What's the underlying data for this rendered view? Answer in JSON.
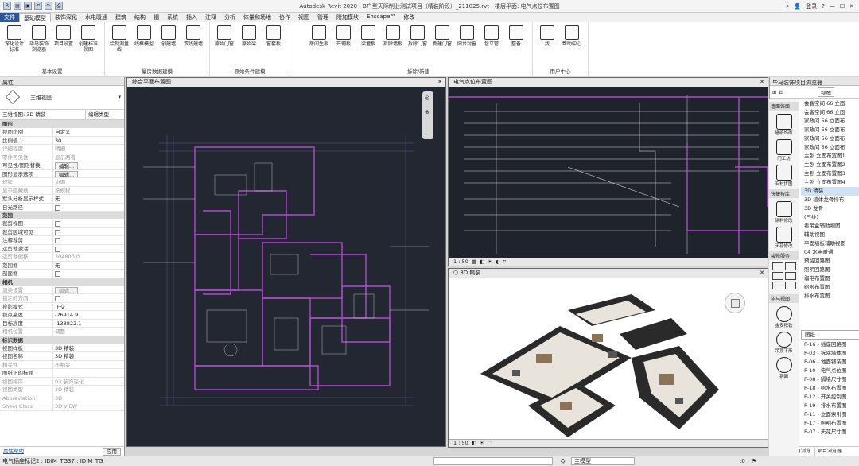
{
  "window": {
    "title": "Autodesk Revit 2020 - B户型天际制业测试项目（精装阶段）_211025.rvt - 楼层平面: 电气点位布置图",
    "user": "登录"
  },
  "tabs": [
    "文件",
    "基础模型",
    "装饰深化",
    "水电暖通",
    "建筑",
    "结构",
    "钢",
    "系统",
    "插入",
    "注释",
    "分析",
    "体量和场地",
    "协作",
    "视图",
    "管理",
    "附加模块",
    "Enscape™",
    "修改"
  ],
  "ribbon": {
    "groups": [
      {
        "label": "基本设置",
        "buttons": [
          "深化设计标准",
          "毕马装饰浏览器",
          "项目设置",
          "创建标准视图"
        ]
      },
      {
        "label": "量房数据建模",
        "buttons": [
          "绘制测量线",
          "线框模型",
          "创建墙",
          "双线建墙"
        ]
      },
      {
        "label": "原始条件建模",
        "buttons": [
          "原始门窗",
          "原始梁",
          "窗套板"
        ]
      },
      {
        "label": "拆除/新建",
        "buttons": [
          "房间生板",
          "开钢板",
          "梁灌板",
          "拆除墙板",
          "拆除门窗",
          "新建门窗",
          "阳台封窗",
          "包立管",
          "整备"
        ]
      },
      {
        "label": "用户中心",
        "buttons": [
          "我",
          "帮助中心"
        ]
      }
    ]
  },
  "properties": {
    "header": "属性",
    "type": "三维视图",
    "selector": "三维视图: 3D 精装",
    "edit_type": "编辑类型",
    "sections": [
      {
        "name": "图形",
        "rows": [
          [
            "视图比例",
            "自定义"
          ],
          [
            "比例值 1:",
            "30"
          ],
          [
            "详细程度",
            "精细"
          ],
          [
            "零件可见性",
            "显示两者"
          ],
          [
            "可见性/图形替换",
            "编辑..."
          ],
          [
            "图形显示选项",
            "编辑..."
          ],
          [
            "规程",
            "协调"
          ],
          [
            "显示隐藏线",
            "按规程"
          ],
          [
            "默认分析显示样式",
            "无"
          ],
          [
            "日光路径",
            ""
          ]
        ]
      },
      {
        "name": "范围",
        "rows": [
          [
            "裁剪视图",
            ""
          ],
          [
            "裁剪区域可见",
            ""
          ],
          [
            "注释裁剪",
            ""
          ],
          [
            "远剪裁激活",
            ""
          ],
          [
            "远剪裁偏移",
            "304800.0"
          ],
          [
            "范围框",
            "无"
          ],
          [
            "剖面框",
            ""
          ]
        ]
      },
      {
        "name": "相机",
        "rows": [
          [
            "渲染设置",
            "编辑..."
          ],
          [
            "锁定的方向",
            ""
          ],
          [
            "投影模式",
            "正交"
          ],
          [
            "视点高度",
            "-26914.9"
          ],
          [
            "目标高度",
            "-138822.1"
          ],
          [
            "相机位置",
            "调整"
          ]
        ]
      },
      {
        "name": "标识数据",
        "rows": [
          [
            "视图样板",
            "3D 精装"
          ],
          [
            "视图名称",
            "3D 精装"
          ],
          [
            "相关性",
            "不相关"
          ],
          [
            "图纸上的标题",
            ""
          ],
          [
            "视图排序",
            "03 装饰深化"
          ],
          [
            "视图类型",
            "3D 精装"
          ],
          [
            "Abbreviation",
            "3D"
          ],
          [
            "Sheet Class",
            "3D VIEW"
          ]
        ]
      }
    ],
    "help_link": "属性帮助",
    "apply": "应用"
  },
  "views": {
    "left": {
      "tab": "综合平面布置图"
    },
    "top_right": {
      "tab": "电气点位布置图",
      "scale": "1 : 50"
    },
    "bottom_right": {
      "tab": "3D 精装",
      "scale": "1 : 50"
    }
  },
  "browser": {
    "header": "毕马装饰项目浏览器",
    "filter": "视图",
    "filter2": "图纸",
    "items": [
      "会客空间 66 立面",
      "会客空间 66 立面",
      "家政间 56 立面布",
      "家政间 56 立面布",
      "家政间 56 立面布",
      "家政间 56 立面布",
      "主卧 立面布置图1",
      "主卧 立面布置图2",
      "主卧 立面布置图3",
      "主卧 立面布置图4",
      "3D 精装",
      "3D 墙体龙骨排布",
      "3D 龙骨",
      "(三维)",
      "看吊盒辅助视图",
      "辅助视图",
      "平面墙板辅助视图",
      "04 水电暖通",
      "预留回路图",
      "照明回路图",
      "弱电布置图",
      "给水布置图",
      "排水布置图"
    ],
    "sheets": [
      "P-16 - 插座回路图",
      "P-03 - 拆除墙体图",
      "P-06 - 地面铺装图",
      "P-10 - 电气点位图",
      "P-08 - 隔墙尺寸图",
      "P-18 - 给水布置图",
      "P-12 - 开关控制图",
      "P-19 - 排水布置图",
      "P-11 - 立面索引图",
      "P-17 - 照明布置图",
      "P-07 - 天花尺寸图"
    ],
    "tab1": "毕马装饰项目浏览",
    "tab2": "项目浏览器"
  },
  "sidebar": {
    "sections": [
      "墙面饰面",
      "快捷按库",
      "装修服务",
      "毕马视图"
    ],
    "buttons": [
      "墙纸饰面",
      "门工坊",
      "石材拼图",
      "涂料修改",
      "天花修改",
      "金安积铁",
      "吊顶下形",
      "铜面"
    ]
  },
  "status": {
    "left": "电气插座标记2 : IDIM_TG37 : IDIM_TG",
    "model": "主模型",
    "zero": ":0"
  }
}
